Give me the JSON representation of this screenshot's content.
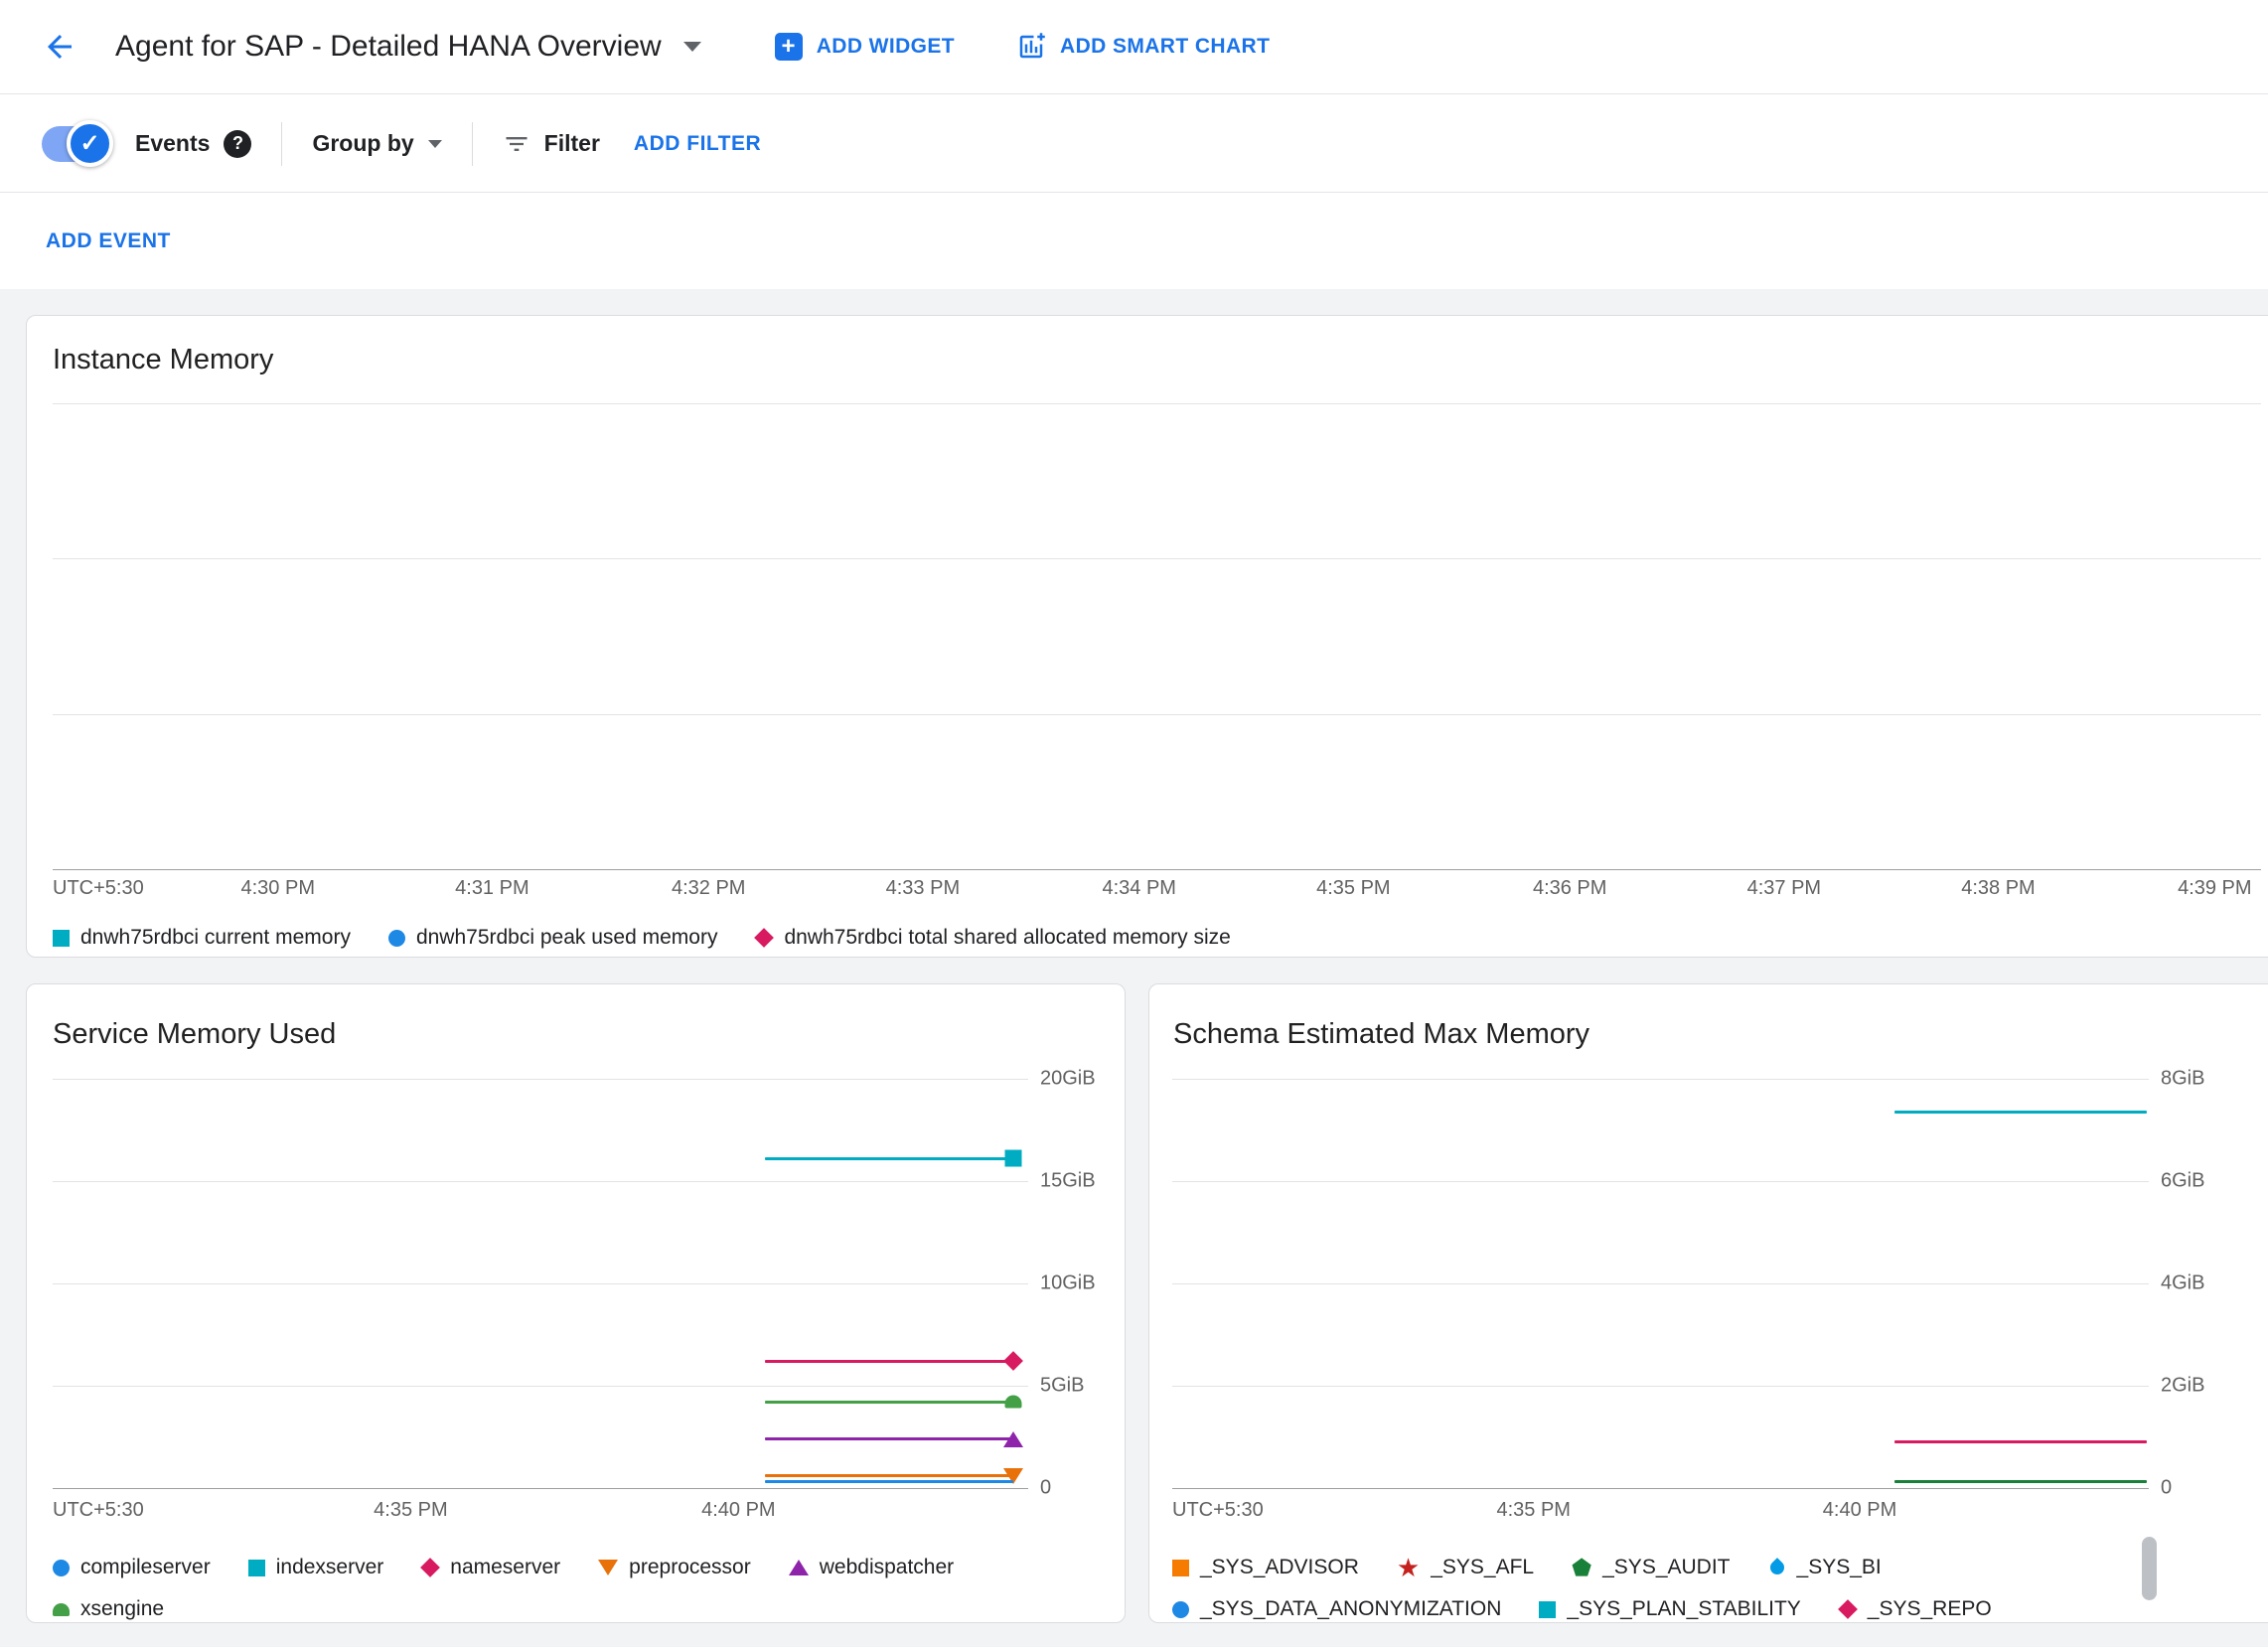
{
  "icons": {
    "plus": "+",
    "check": "✓",
    "question_mark": "?"
  },
  "colors": {
    "link_blue": "#1a73e8",
    "text_dark": "#202124",
    "text_secondary": "#5f6368",
    "axis_label": "#616161",
    "gridline": "#e3e3e3",
    "axis_line": "#9e9e9e",
    "card_border": "#dadce0",
    "page_bg": "#f1f3f4"
  },
  "header": {
    "title": "Agent for SAP - Detailed HANA Overview",
    "add_widget_label": "ADD WIDGET",
    "add_smart_chart_label": "ADD SMART CHART"
  },
  "toolbar": {
    "events_label": "Events",
    "events_toggle_state": "on",
    "group_by_label": "Group by",
    "filter_label": "Filter",
    "add_filter_label": "ADD FILTER"
  },
  "event_bar": {
    "add_event_label": "ADD EVENT"
  },
  "charts": [
    {
      "title": "Instance Memory",
      "type": "line",
      "timezone_label": "UTC+5:30",
      "y_max_gib": null,
      "y_ticks": [
        {
          "label": "",
          "frac": 0
        },
        {
          "label": "",
          "frac": 0.333
        },
        {
          "label": "",
          "frac": 0.667
        },
        {
          "label": "",
          "frac": 1,
          "axis": true
        }
      ],
      "x_ticks": [
        {
          "label": "4:30 PM",
          "pos": 0.102
        },
        {
          "label": "4:31 PM",
          "pos": 0.199
        },
        {
          "label": "4:32 PM",
          "pos": 0.297
        },
        {
          "label": "4:33 PM",
          "pos": 0.394
        },
        {
          "label": "4:34 PM",
          "pos": 0.492
        },
        {
          "label": "4:35 PM",
          "pos": 0.589
        },
        {
          "label": "4:36 PM",
          "pos": 0.687
        },
        {
          "label": "4:37 PM",
          "pos": 0.784
        },
        {
          "label": "4:38 PM",
          "pos": 0.881
        },
        {
          "label": "4:39 PM",
          "pos": 0.979
        }
      ],
      "series": [],
      "legend": [
        {
          "label": "dnwh75rdbci current memory",
          "marker": "square",
          "color": "#00acc1"
        },
        {
          "label": "dnwh75rdbci peak used memory",
          "marker": "circle",
          "color": "#1e88e5"
        },
        {
          "label": "dnwh75rdbci total shared allocated memory size",
          "marker": "diamond",
          "color": "#d81b60"
        }
      ]
    },
    {
      "title": "Service Memory Used",
      "type": "line",
      "timezone_label": "UTC+5:30",
      "y_max_gib": 20,
      "y_ticks": [
        {
          "label": "20GiB",
          "frac": 0
        },
        {
          "label": "15GiB",
          "frac": 0.25
        },
        {
          "label": "10GiB",
          "frac": 0.5
        },
        {
          "label": "5GiB",
          "frac": 0.75
        },
        {
          "label": "0",
          "frac": 1,
          "axis": true
        }
      ],
      "x_ticks": [
        {
          "label": "4:35 PM",
          "pos": 0.367
        },
        {
          "label": "4:40 PM",
          "pos": 0.703
        }
      ],
      "series": [
        {
          "name": "indexserver",
          "color": "#00acc1",
          "marker": "square",
          "value_gib": 16.1,
          "x0": 0.73,
          "x1": 0.985
        },
        {
          "name": "nameserver",
          "color": "#d81b60",
          "marker": "diamond",
          "value_gib": 6.2,
          "x0": 0.73,
          "x1": 0.985
        },
        {
          "name": "xsengine",
          "color": "#43a047",
          "marker": "dome",
          "value_gib": 4.2,
          "x0": 0.73,
          "x1": 0.985
        },
        {
          "name": "webdispatcher",
          "color": "#8e24aa",
          "marker": "triangle-up",
          "value_gib": 2.4,
          "x0": 0.73,
          "x1": 0.985
        },
        {
          "name": "preprocessor",
          "color": "#e8710a",
          "marker": "triangle-down",
          "value_gib": 0.6,
          "x0": 0.73,
          "x1": 0.985
        },
        {
          "name": "compileserver",
          "color": "#1e88e5",
          "marker": null,
          "value_gib": 0.3,
          "x0": 0.73,
          "x1": 0.985
        }
      ],
      "legend": [
        {
          "label": "compileserver",
          "marker": "circle",
          "color": "#1e88e5"
        },
        {
          "label": "indexserver",
          "marker": "square",
          "color": "#00acc1"
        },
        {
          "label": "nameserver",
          "marker": "diamond",
          "color": "#d81b60"
        },
        {
          "label": "preprocessor",
          "marker": "triangle-down",
          "color": "#e8710a"
        },
        {
          "label": "webdispatcher",
          "marker": "triangle-up",
          "color": "#8e24aa"
        },
        {
          "label": "xsengine",
          "marker": "dome",
          "color": "#43a047"
        }
      ]
    },
    {
      "title": "Schema Estimated Max Memory",
      "type": "line",
      "timezone_label": "UTC+5:30",
      "y_max_gib": 8,
      "y_ticks": [
        {
          "label": "8GiB",
          "frac": 0
        },
        {
          "label": "6GiB",
          "frac": 0.25
        },
        {
          "label": "4GiB",
          "frac": 0.5
        },
        {
          "label": "2GiB",
          "frac": 0.75
        },
        {
          "label": "0",
          "frac": 1,
          "axis": true
        }
      ],
      "x_ticks": [
        {
          "label": "4:35 PM",
          "pos": 0.37
        },
        {
          "label": "4:40 PM",
          "pos": 0.704
        }
      ],
      "series": [
        {
          "name": "_SYS_PLAN_STABILITY",
          "color": "#00acc1",
          "marker": null,
          "value_gib": 7.35,
          "x0": 0.74,
          "x1": 0.998
        },
        {
          "name": "_SYS_REPO",
          "color": "#d81b60",
          "marker": null,
          "value_gib": 0.9,
          "x0": 0.74,
          "x1": 0.998
        },
        {
          "name": "_SYS_AUDIT",
          "color": "#188038",
          "marker": null,
          "value_gib": 0.12,
          "x0": 0.74,
          "x1": 0.998
        }
      ],
      "legend": [
        {
          "label": "_SYS_ADVISOR",
          "marker": "square",
          "color": "#f57c00"
        },
        {
          "label": "_SYS_AFL",
          "marker": "star",
          "color": "#c5221f"
        },
        {
          "label": "_SYS_AUDIT",
          "marker": "pentagon",
          "color": "#188038"
        },
        {
          "label": "_SYS_BI",
          "marker": "drop",
          "color": "#039be5"
        },
        {
          "label": "_SYS_DATA_ANONYMIZATION",
          "marker": "circle",
          "color": "#1e88e5"
        },
        {
          "label": "_SYS_PLAN_STABILITY",
          "marker": "square",
          "color": "#00acc1"
        },
        {
          "label": "_SYS_REPO",
          "marker": "diamond",
          "color": "#d81b60"
        }
      ]
    }
  ]
}
